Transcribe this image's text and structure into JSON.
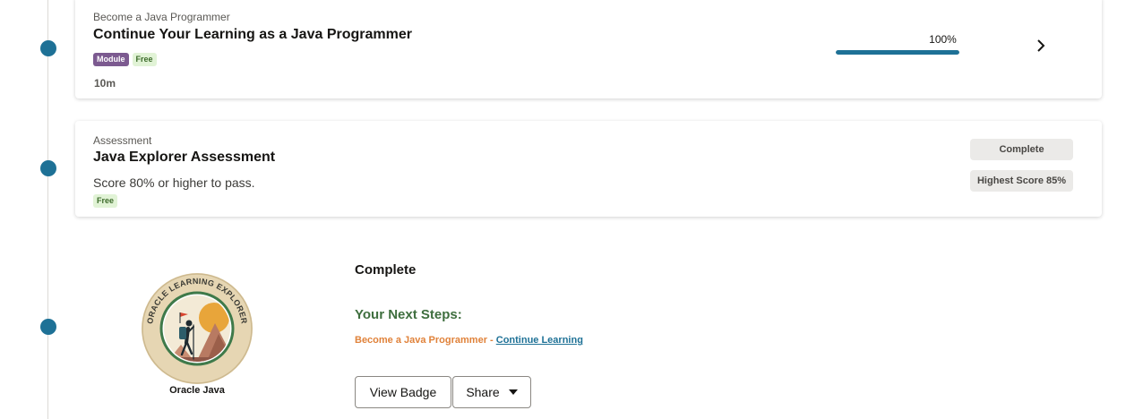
{
  "module_card": {
    "eyebrow": "Become a Java Programmer",
    "title": "Continue Your Learning as a Java Programmer",
    "badges": [
      "Module",
      "Free"
    ],
    "duration": "10m",
    "progress_label": "100%",
    "progress": 1.0,
    "icon": "chevron-right-icon"
  },
  "assessment_card": {
    "eyebrow": "Assessment",
    "title": "Java Explorer Assessment",
    "description": "Score 80% or higher to pass.",
    "badge": "Free",
    "status": "Complete",
    "score": "Highest Score 85%"
  },
  "badge": {
    "ring_text": "ORACLE LEARNING EXPLORER",
    "caption": "Oracle Java"
  },
  "completion": {
    "status": "Complete",
    "next_steps_heading": "Your Next Steps:",
    "course": "Become a Java Programmer",
    "separator": " - ",
    "link": "Continue Learning",
    "view_badge_button": "View Badge",
    "share_button": "Share"
  },
  "colors": {
    "accent": "#1e7196",
    "module_badge": "#7c5a90",
    "free_badge_bg": "#e1f3d6",
    "next_steps": "#3f6f3f",
    "course_link": "#e0823a"
  }
}
